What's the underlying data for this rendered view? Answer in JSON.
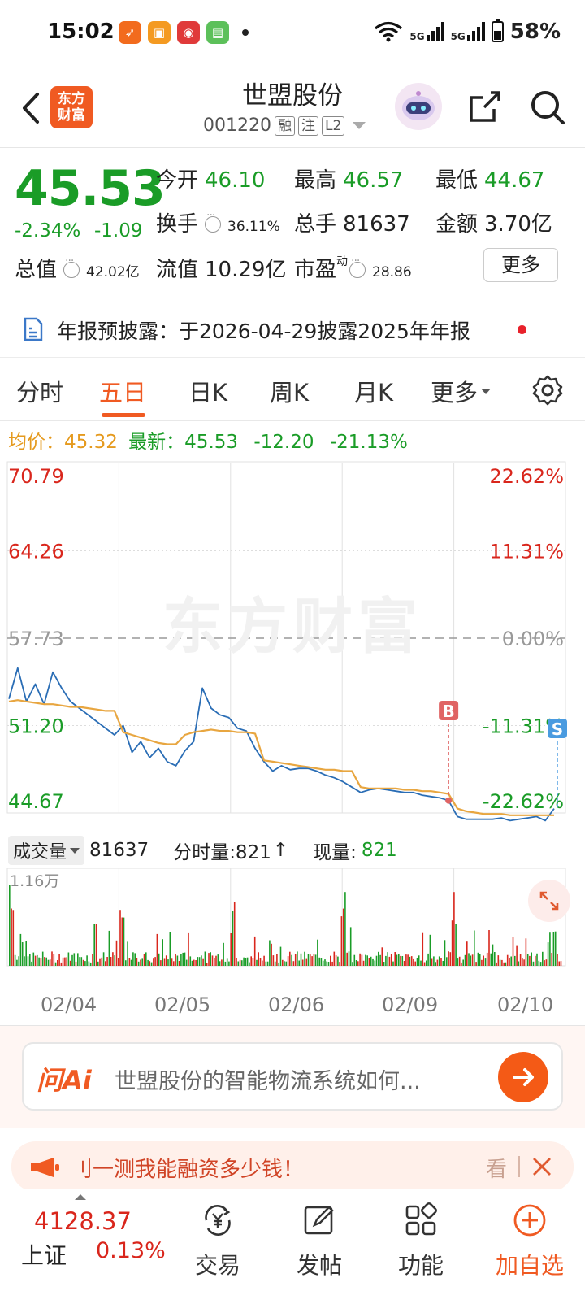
{
  "status": {
    "time": "15:02",
    "battery": "58%",
    "signal1": "5G",
    "signal2": "5G"
  },
  "header": {
    "logo_line1": "东方",
    "logo_line2": "财富",
    "stock_name": "世盟股份",
    "stock_code": "001220",
    "tags": [
      "融",
      "注",
      "L2"
    ]
  },
  "quote": {
    "price": "45.53",
    "change_pct": "-2.34%",
    "change_abs": "-1.09",
    "open_label": "今开",
    "open": "46.10",
    "high_label": "最高",
    "high": "46.57",
    "low_label": "最低",
    "low": "44.67",
    "turnover_label": "换手",
    "turnover": "36.11%",
    "volume_label": "总手",
    "volume": "81637",
    "amount_label": "金额",
    "amount": "3.70亿",
    "mktcap_label": "总值",
    "mktcap": "42.02亿",
    "float_label": "流值",
    "float": "10.29亿",
    "pe_label": "市盈",
    "pe_sup": "动",
    "pe": "28.86",
    "more_label": "更多"
  },
  "announcement": {
    "text": "年报预披露：于2026-04-29披露2025年年报"
  },
  "tabs": [
    {
      "label": "分时"
    },
    {
      "label": "五日"
    },
    {
      "label": "日K"
    },
    {
      "label": "周K"
    },
    {
      "label": "月K"
    },
    {
      "label": "更多"
    }
  ],
  "chart_info": {
    "avg_label": "均价：",
    "avg": "45.32",
    "latest_label": "最新：",
    "latest": "45.53",
    "chg": "-12.20",
    "chg_pct": "-21.13%"
  },
  "chart_data": {
    "type": "line",
    "title": "",
    "y_labels_left": [
      "70.79",
      "64.26",
      "57.73",
      "51.20",
      "44.67"
    ],
    "y_labels_right": [
      "22.62%",
      "11.31%",
      "0.00%",
      "-11.31%",
      "-22.62%"
    ],
    "ylim": [
      44.67,
      70.79
    ],
    "prev_close": 57.73,
    "x_labels": [
      "02/04",
      "02/05",
      "02/06",
      "02/09",
      "02/10"
    ],
    "series": [
      {
        "name": "",
        "color": "#2a6db5",
        "values": [
          53.2,
          55.5,
          53.0,
          54.3,
          52.8,
          55.2,
          54.0,
          53.0,
          52.5,
          52.0,
          51.5,
          51.0,
          50.5,
          51.2,
          49.2,
          50.0,
          48.8,
          49.5,
          48.5,
          48.2,
          49.3,
          50.0,
          54.0,
          52.5,
          52.0,
          51.8,
          51.0,
          50.8,
          49.5,
          48.5,
          47.8,
          48.2,
          47.9,
          48.0,
          48.0,
          47.8,
          47.5,
          47.3,
          47.0,
          46.6,
          46.2,
          46.4,
          46.5,
          46.4,
          46.3,
          46.2,
          46.2,
          46.0,
          45.9,
          45.8,
          45.6,
          44.4,
          44.2,
          44.2,
          44.2,
          44.2,
          44.3,
          44.1,
          44.2,
          44.3,
          44.4,
          44.1,
          45.0
        ]
      },
      {
        "name": "均价",
        "color": "#e8a640",
        "values": [
          53.0,
          53.1,
          53.0,
          52.9,
          52.8,
          52.8,
          52.7,
          52.6,
          52.6,
          52.5,
          52.4,
          52.3,
          52.3,
          50.7,
          50.5,
          50.3,
          50.1,
          49.9,
          49.8,
          49.8,
          50.5,
          50.7,
          50.8,
          50.9,
          50.8,
          50.8,
          50.7,
          50.7,
          50.6,
          48.6,
          48.5,
          48.4,
          48.3,
          48.2,
          48.1,
          48.0,
          47.9,
          47.9,
          47.8,
          47.8,
          46.6,
          46.5,
          46.5,
          46.5,
          46.5,
          46.4,
          46.4,
          46.3,
          46.3,
          46.2,
          46.1,
          45.0,
          44.8,
          44.7,
          44.6,
          44.6,
          44.6,
          44.5,
          44.5,
          44.5,
          44.5,
          44.5,
          44.5
        ]
      }
    ],
    "markers": [
      {
        "label": "B",
        "color": "#e06464"
      },
      {
        "label": "S",
        "color": "#4a9be0"
      }
    ]
  },
  "volume": {
    "select_label": "成交量",
    "total": "81637",
    "tick_label": "分时量:821",
    "current_label": "现量:",
    "current": "821",
    "max_label": "1.16万"
  },
  "ai": {
    "logo": "问Ai",
    "prompt": "世盟股份的智能物流系统如何..."
  },
  "promo": {
    "text": "刂一测我能融资多少钱！",
    "look": "看"
  },
  "bottom": {
    "index_value": "4128.37",
    "index_name": "上证",
    "index_change": "0.13%",
    "trade": "交易",
    "post": "发帖",
    "func": "功能",
    "add": "加自选"
  },
  "colors": {
    "accent": "#f05a22",
    "down": "#1a9c27",
    "up": "#d9261c",
    "price_line": "#2a6db5",
    "avg_line": "#e8a640"
  }
}
